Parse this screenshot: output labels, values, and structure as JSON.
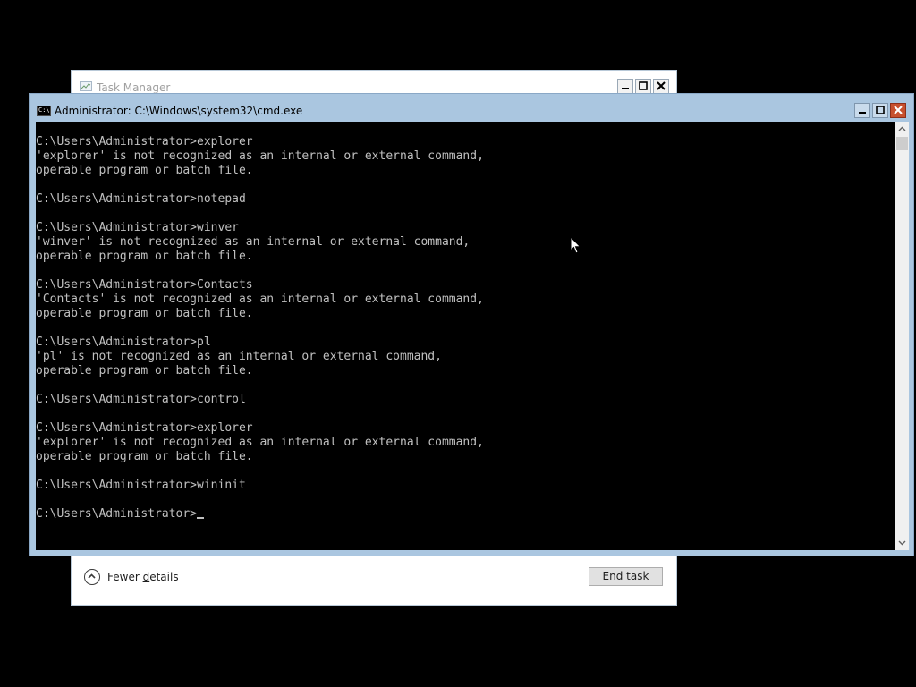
{
  "task_manager": {
    "title": "Task Manager",
    "fewer_details_label": "Fewer details",
    "fewer_details_mnemonic": "d",
    "end_task_label": "End task",
    "end_task_mnemonic": "E"
  },
  "cmd": {
    "title": "Administrator: C:\\Windows\\system32\\cmd.exe",
    "icon_text": "C:\\",
    "lines": [
      "C:\\Users\\Administrator>explorer",
      "'explorer' is not recognized as an internal or external command,",
      "operable program or batch file.",
      "",
      "C:\\Users\\Administrator>notepad",
      "",
      "C:\\Users\\Administrator>winver",
      "'winver' is not recognized as an internal or external command,",
      "operable program or batch file.",
      "",
      "C:\\Users\\Administrator>Contacts",
      "'Contacts' is not recognized as an internal or external command,",
      "operable program or batch file.",
      "",
      "C:\\Users\\Administrator>pl",
      "'pl' is not recognized as an internal or external command,",
      "operable program or batch file.",
      "",
      "C:\\Users\\Administrator>control",
      "",
      "C:\\Users\\Administrator>explorer",
      "'explorer' is not recognized as an internal or external command,",
      "operable program or batch file.",
      "",
      "C:\\Users\\Administrator>wininit",
      "",
      "C:\\Users\\Administrator>"
    ]
  },
  "colors": {
    "console_background": "#000000",
    "console_text": "#c0c0c0",
    "cmd_titlebar": "#aac6e0",
    "close_button": "#c7502e",
    "desktop": "#000000"
  },
  "icons": {
    "task_manager_icon": "task-manager-icon",
    "cmd_icon": "cmd-icon",
    "minimize": "minimize-icon",
    "maximize": "maximize-icon",
    "close": "close-icon",
    "chevron": "chevron-up-icon",
    "pointer": "mouse-pointer-icon"
  }
}
